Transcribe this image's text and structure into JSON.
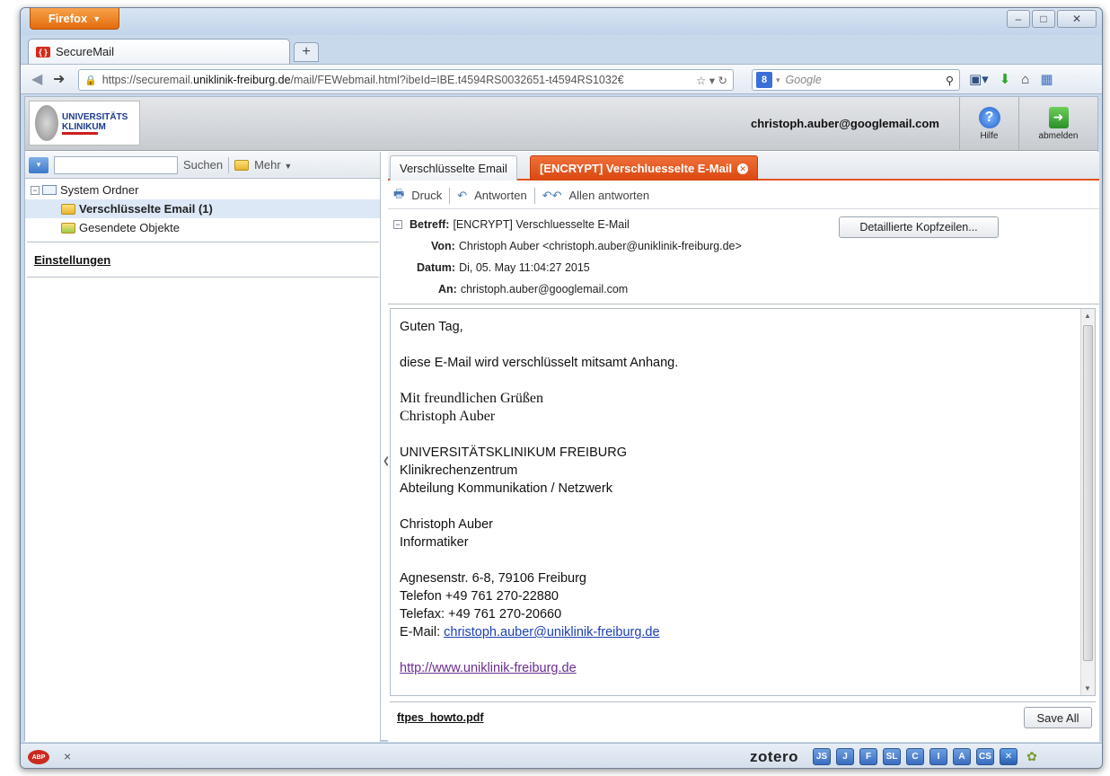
{
  "browser": {
    "menu_button": "Firefox",
    "tab_title": "SecureMail",
    "new_tab": "+",
    "url_prefix": "https://securemail.",
    "url_host": "uniklinik-freiburg.de",
    "url_path": "/mail/FEWebmail.html?ibeId=IBE.t4594RS0032651-t4594RS1032€",
    "search_placeholder": "Google"
  },
  "app": {
    "logo_line1": "UNIVERSITÄTS",
    "logo_line2": "KLINIKUM",
    "user_email": "christoph.auber@googlemail.com",
    "help_label": "Hilfe",
    "logout_label": "abmelden"
  },
  "left": {
    "search_button": "Suchen",
    "more_button": "Mehr",
    "root_folder": "System Ordner",
    "folders": [
      {
        "label": "Verschlüsselte Email (1)"
      },
      {
        "label": "Gesendete Objekte"
      }
    ],
    "settings": "Einstellungen"
  },
  "mail": {
    "tabs": [
      {
        "label": "Verschlüsselte Email"
      },
      {
        "label": "[ENCRYPT] Verschluesselte E-Mail"
      }
    ],
    "actions": {
      "print": "Druck",
      "reply": "Antworten",
      "reply_all": "Allen antworten"
    },
    "headers": {
      "subject_label": "Betreff:",
      "subject": "[ENCRYPT] Verschluesselte E-Mail",
      "from_label": "Von:",
      "from": "Christoph Auber <christoph.auber@uniklinik-freiburg.de>",
      "date_label": "Datum:",
      "date": "Di, 05. May 11:04:27 2015",
      "to_label": "An:",
      "to": "christoph.auber@googlemail.com",
      "detail_button": "Detaillierte Kopfzeilen..."
    },
    "body": {
      "greeting": "Guten Tag,",
      "line1": "diese E-Mail wird verschlüsselt mitsamt Anhang.",
      "closing1": "Mit freundlichen Grüßen",
      "closing2": "Christoph Auber",
      "org1": "UNIVERSITÄTSKLINIKUM FREIBURG",
      "org2": "Klinikrechenzentrum",
      "org3": "Abteilung Kommunikation / Netzwerk",
      "name": "Christoph Auber",
      "title": "Informatiker",
      "address": "Agnesenstr. 6-8, 79106 Freiburg",
      "phone": "Telefon +49 761  270-22880",
      "fax": "Telefax: +49 761  270-20660",
      "email_label": "E-Mail: ",
      "email": "christoph.auber@uniklinik-freiburg.de",
      "website": "http://www.uniklinik-freiburg.de"
    },
    "attachment": "ftpes_howto.pdf",
    "save_all": "Save All"
  },
  "statusbar": {
    "abp": "ABP",
    "close": "×",
    "zotero": "zotero",
    "addons": [
      "JS",
      "J",
      "F",
      "SL",
      "C",
      "I",
      "A",
      "CS"
    ]
  }
}
